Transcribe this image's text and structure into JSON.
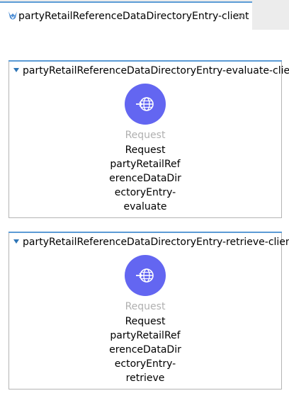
{
  "tab": {
    "title": "partyRetailReferenceDataDirectoryEntry-client",
    "close_symbol": "×",
    "icon": "mule-app-icon"
  },
  "flows": [
    {
      "title": "partyRetailReferenceDataDirectoryEntry-evaluate-client",
      "processor": {
        "icon": "http-request-globe-icon",
        "type": "Request",
        "label_lines": [
          "Request",
          "partyRetailRef",
          "erenceDataDir",
          "ectoryEntry-",
          "evaluate"
        ]
      }
    },
    {
      "title": "partyRetailReferenceDataDirectoryEntry-retrieve-client",
      "processor": {
        "icon": "http-request-globe-icon",
        "type": "Request",
        "label_lines": [
          "Request",
          "partyRetailRef",
          "erenceDataDir",
          "ectoryEntry-",
          "retrieve"
        ]
      }
    }
  ],
  "colors": {
    "accent_blue": "#5b9bd5",
    "processor_circle": "#6366f1"
  }
}
